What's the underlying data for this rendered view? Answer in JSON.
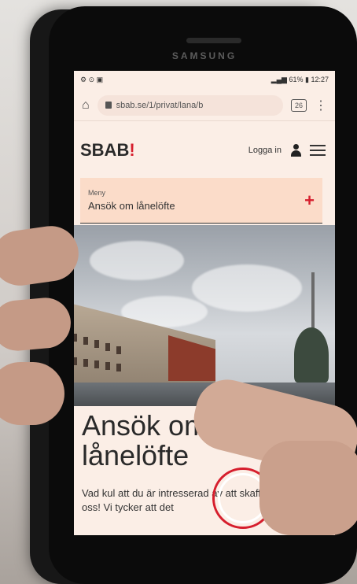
{
  "device": {
    "brand": "SAMSUNG"
  },
  "status_bar": {
    "battery": "61%",
    "time": "12:27"
  },
  "browser": {
    "url": "sbab.se/1/privat/lana/b",
    "tab_count": "26"
  },
  "site": {
    "logo": "SBAB",
    "logo_mark": "!",
    "login_label": "Logga in"
  },
  "menu": {
    "label": "Meny",
    "value": "Ansök om lånelöfte"
  },
  "hero": {
    "headline_line1": "Ansök om",
    "headline_line2": "lånelöfte",
    "body": "Vad kul att du är intresserad av att skaffa bolån hos oss! Vi tycker att det"
  },
  "colors": {
    "accent": "#d61e2d",
    "page_bg": "#fbeee6",
    "menu_bg": "#fbdcc9"
  }
}
